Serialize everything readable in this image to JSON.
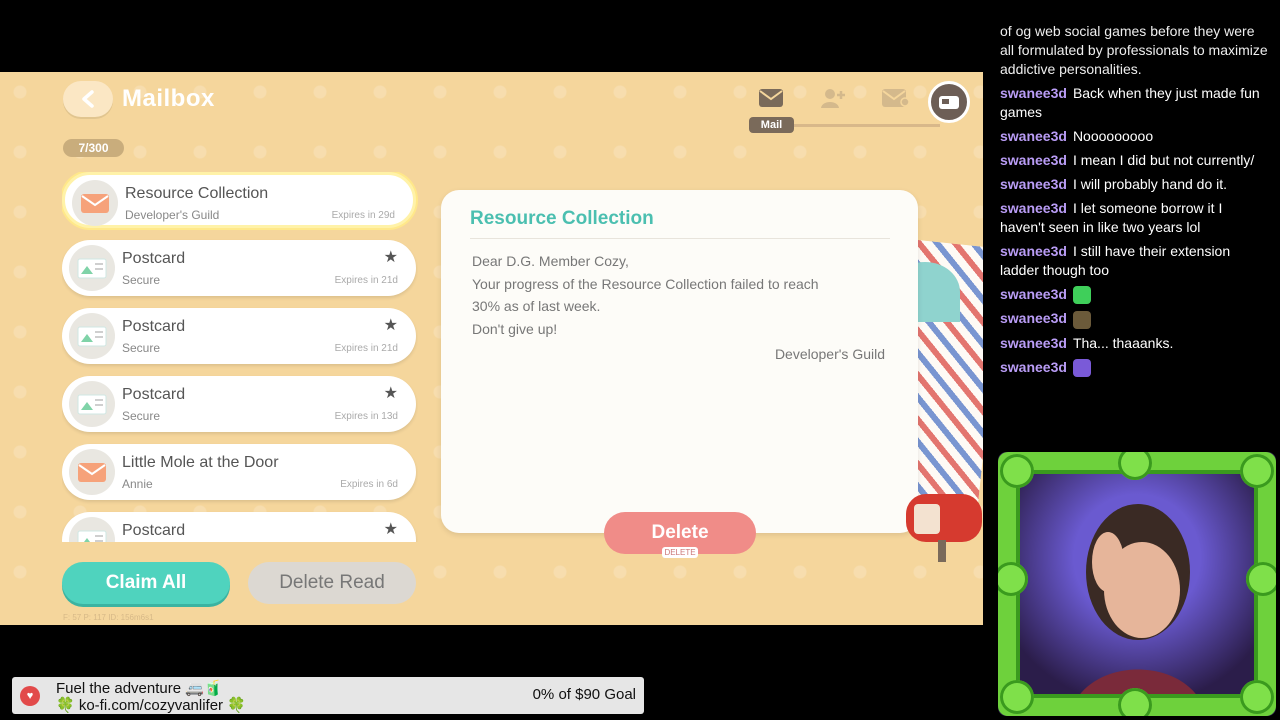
{
  "game": {
    "title": "Mailbox",
    "counter": "7/300",
    "tab_label": "Mail",
    "mail_items": [
      {
        "title": "Resource Collection",
        "sub": "Developer's Guild",
        "expires": "Expires in 29d",
        "starred": false,
        "selected": true
      },
      {
        "title": "Postcard",
        "sub": "Secure",
        "expires": "Expires in 21d",
        "starred": true,
        "selected": false
      },
      {
        "title": "Postcard",
        "sub": "Secure",
        "expires": "Expires in 21d",
        "starred": true,
        "selected": false
      },
      {
        "title": "Postcard",
        "sub": "Secure",
        "expires": "Expires in 13d",
        "starred": true,
        "selected": false
      },
      {
        "title": "Little Mole at the Door",
        "sub": "Annie",
        "expires": "Expires in 6d",
        "starred": false,
        "selected": false
      },
      {
        "title": "Postcard",
        "sub": "",
        "expires": "",
        "starred": true,
        "selected": false
      }
    ],
    "claim_all_label": "Claim All",
    "delete_read_label": "Delete Read",
    "footer_info": "F: 57   P: 117   ID: 156m6s1",
    "letter": {
      "title": "Resource Collection",
      "greeting": "Dear D.G. Member Cozy,",
      "line1": "Your progress of the Resource Collection failed to reach",
      "line2": "30% as of last week.",
      "line3": "Don't give up!",
      "signature": "Developer's Guild"
    },
    "delete_label": "Delete",
    "delete_key": "DELETE",
    "colors": {
      "accent": "#4bbfb0",
      "claim": "#4fd3be",
      "delete": "#f08c88",
      "bg": "#f5d69c"
    }
  },
  "chat": {
    "top_text": "of og web social games before they were all formulated by professionals to maximize addictive personalities.",
    "messages": [
      {
        "user": "swanee3d",
        "text": "Back when they just made fun games"
      },
      {
        "user": "swanee3d",
        "text": "Nooooooooo"
      },
      {
        "user": "swanee3d",
        "text": "I mean I did but not currently/"
      },
      {
        "user": "swanee3d",
        "text": "I will probably hand do it."
      },
      {
        "user": "swanee3d",
        "text": "I let someone borrow it I haven't seen in like two years lol"
      },
      {
        "user": "swanee3d",
        "text": "I still have their extension ladder though too"
      },
      {
        "user": "swanee3d",
        "text": "",
        "emote": "#3fcf5a"
      },
      {
        "user": "swanee3d",
        "text": "",
        "emote": "#6b5a3a"
      },
      {
        "user": "swanee3d",
        "text": "Tha... thaaanks."
      },
      {
        "user": "swanee3d",
        "text": "",
        "emote": "#7a5ad8"
      }
    ]
  },
  "donation": {
    "line1": "Fuel the adventure 🚐🧃",
    "line2": "🍀 ko-fi.com/cozyvanlifer 🍀",
    "goal": "0% of $90 Goal"
  }
}
